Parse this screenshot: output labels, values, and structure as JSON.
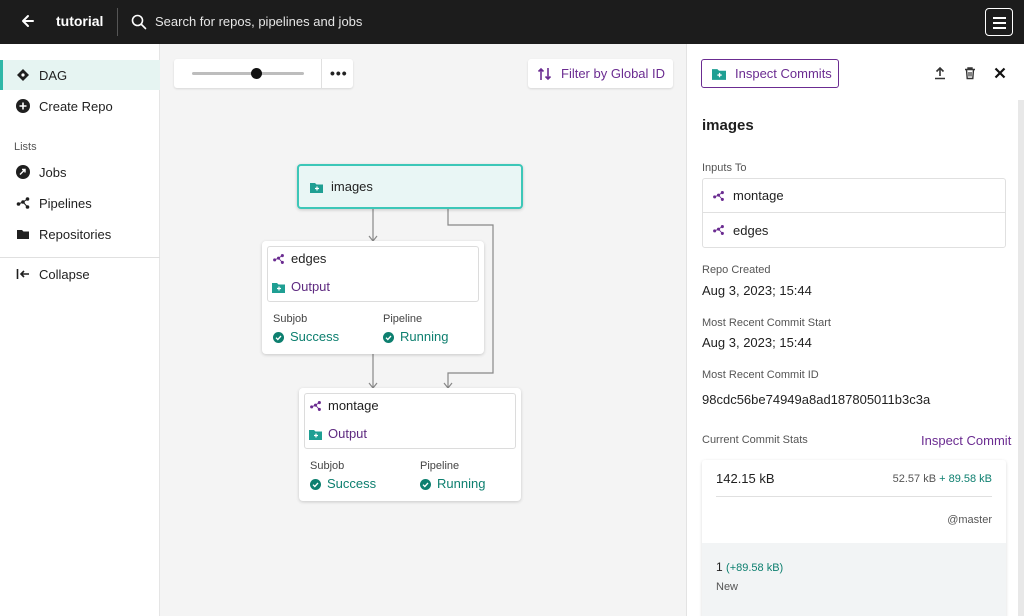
{
  "header": {
    "project": "tutorial",
    "search_placeholder": "Search for repos, pipelines and jobs"
  },
  "sidebar": {
    "items": [
      {
        "label": "DAG",
        "icon": "dag-icon",
        "active": true
      },
      {
        "label": "Create Repo",
        "icon": "plus-circle-icon"
      }
    ],
    "lists_heading": "Lists",
    "lists": [
      {
        "label": "Jobs",
        "icon": "jobs-icon"
      },
      {
        "label": "Pipelines",
        "icon": "pipeline-icon"
      },
      {
        "label": "Repositories",
        "icon": "folder-icon"
      }
    ],
    "collapse_label": "Collapse"
  },
  "canvas": {
    "filter_label": "Filter by Global ID",
    "repo_node": {
      "name": "images"
    },
    "pipelines": [
      {
        "name": "edges",
        "output": "Output",
        "subjob_label": "Subjob",
        "subjob_status": "Success",
        "pipeline_label": "Pipeline",
        "pipeline_status": "Running"
      },
      {
        "name": "montage",
        "output": "Output",
        "subjob_label": "Subjob",
        "subjob_status": "Success",
        "pipeline_label": "Pipeline",
        "pipeline_status": "Running"
      }
    ]
  },
  "panel": {
    "inspect_commits_label": "Inspect Commits",
    "title": "images",
    "inputs_to_label": "Inputs To",
    "inputs_to": [
      "montage",
      "edges"
    ],
    "repo_created_label": "Repo Created",
    "repo_created": "Aug 3, 2023; 15:44",
    "recent_commit_start_label": "Most Recent Commit Start",
    "recent_commit_start": "Aug 3, 2023; 15:44",
    "recent_commit_id_label": "Most Recent Commit ID",
    "recent_commit_id": "98cdc56be74949a8ad187805011b3c3a",
    "commit_stats_label": "Current Commit Stats",
    "inspect_commit_link": "Inspect Commit",
    "stats": {
      "size": "142.15 kB",
      "delta_base": "52.57 kB",
      "delta_add": "+ 89.58 kB",
      "branch": "@master",
      "file_count": "1",
      "file_delta": "(+89.58 kB)",
      "file_state": "New"
    }
  },
  "colors": {
    "topbar": "#1c1c1c",
    "accent_purple": "#6b2c91",
    "accent_teal": "#2fb7a8",
    "success_green": "#0d7f6f"
  }
}
